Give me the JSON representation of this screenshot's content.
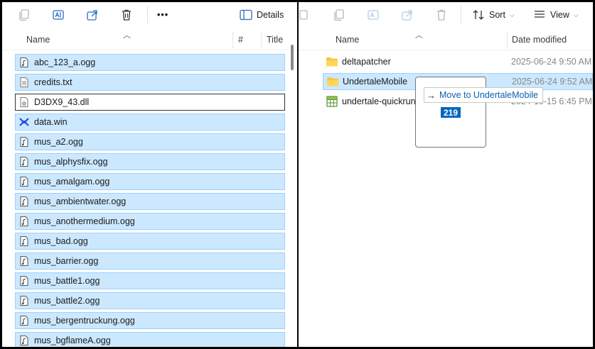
{
  "left_pane": {
    "toolbar": {
      "details_label": "Details",
      "more_glyph": "•••"
    },
    "columns": {
      "name": "Name",
      "number": "#",
      "title": "Title"
    },
    "files": [
      {
        "name": "abc_123_a.ogg",
        "icon": "audio-file-icon"
      },
      {
        "name": "credits.txt",
        "icon": "text-file-icon"
      },
      {
        "name": "D3DX9_43.dll",
        "icon": "dll-file-icon"
      },
      {
        "name": "data.win",
        "icon": "data-file-icon"
      },
      {
        "name": "mus_a2.ogg",
        "icon": "audio-file-icon"
      },
      {
        "name": "mus_alphysfix.ogg",
        "icon": "audio-file-icon"
      },
      {
        "name": "mus_amalgam.ogg",
        "icon": "audio-file-icon"
      },
      {
        "name": "mus_ambientwater.ogg",
        "icon": "audio-file-icon"
      },
      {
        "name": "mus_anothermedium.ogg",
        "icon": "audio-file-icon"
      },
      {
        "name": "mus_bad.ogg",
        "icon": "audio-file-icon"
      },
      {
        "name": "mus_barrier.ogg",
        "icon": "audio-file-icon"
      },
      {
        "name": "mus_battle1.ogg",
        "icon": "audio-file-icon"
      },
      {
        "name": "mus_battle2.ogg",
        "icon": "audio-file-icon"
      },
      {
        "name": "mus_bergentruckung.ogg",
        "icon": "audio-file-icon"
      },
      {
        "name": "mus_bgflameA.ogg",
        "icon": "audio-file-icon"
      }
    ]
  },
  "right_pane": {
    "toolbar": {
      "sort_label": "Sort",
      "view_label": "View"
    },
    "columns": {
      "name": "Name",
      "date_modified": "Date modified"
    },
    "items": [
      {
        "name": "deltapatcher",
        "date": "2025-06-24 9:50 AM",
        "icon": "folder-icon"
      },
      {
        "name": "UndertaleMobile",
        "date": "2025-06-24 9:52 AM",
        "icon": "folder-icon"
      },
      {
        "name": "undertale-quickrun-",
        "date": "2024-10-15 6:45 PM",
        "icon": "spreadsheet-file-icon"
      }
    ]
  },
  "drag": {
    "tooltip": "Move to UndertaleMobile",
    "count": "219"
  },
  "colors": {
    "selection_bg": "#cce8ff",
    "selection_border": "#99d1ff",
    "accent": "#0067c0",
    "folder": "#f4c542"
  }
}
